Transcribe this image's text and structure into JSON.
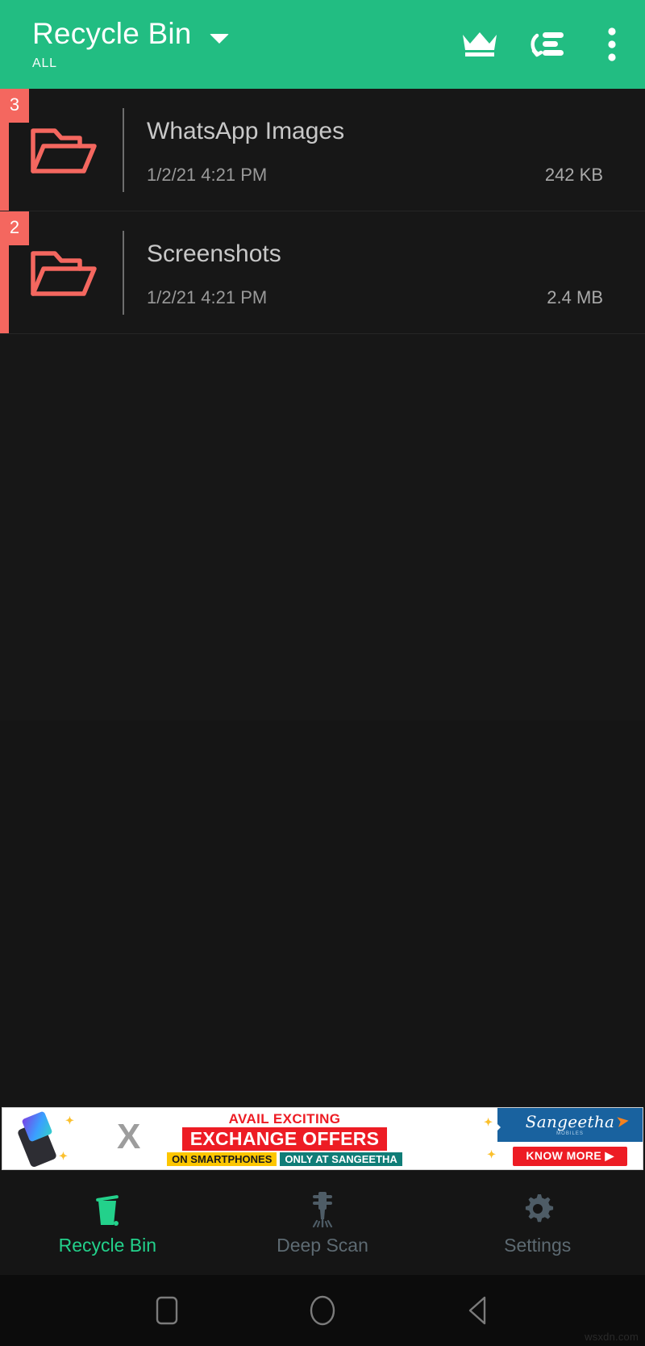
{
  "appbar": {
    "title": "Recycle Bin",
    "subtitle": "ALL",
    "dropdown_icon": "chevron-down-icon",
    "actions": [
      {
        "name": "crown-icon",
        "label": "Premium"
      },
      {
        "name": "sort-icon",
        "label": "Sort"
      },
      {
        "name": "overflow-menu-icon",
        "label": "More options"
      }
    ],
    "background_color": "#22bd82",
    "text_color": "#ffffff"
  },
  "list": {
    "accent_color": "#f4675f",
    "items": [
      {
        "badge": "3",
        "icon": "open-folder-icon",
        "title": "WhatsApp Images",
        "date": "1/2/21 4:21 PM",
        "size": "242 KB"
      },
      {
        "badge": "2",
        "icon": "open-folder-icon",
        "title": "Screenshots",
        "date": "1/2/21 4:21 PM",
        "size": "2.4 MB"
      }
    ]
  },
  "ad": {
    "line1": "AVAIL EXCITING",
    "line2": "EXCHANGE OFFERS",
    "tag_left": "ON SMARTPHONES",
    "tag_right": "ONLY AT SANGEETHA",
    "brand": "Sangeetha",
    "brand_tagline": "MOBILES",
    "cta": "KNOW MORE ▶",
    "cross_mark": "X",
    "colors": {
      "red": "#ed1c24",
      "yellow": "#fdc600",
      "teal": "#0f7d77",
      "blue": "#19629f",
      "orange": "#f5821f"
    }
  },
  "bottomnav": {
    "active_color": "#23d18b",
    "idle_color": "#5d6a72",
    "items": [
      {
        "icon": "trash-bin-icon",
        "label": "Recycle Bin",
        "active": true
      },
      {
        "icon": "jackhammer-icon",
        "label": "Deep Scan",
        "active": false
      },
      {
        "icon": "gear-icon",
        "label": "Settings",
        "active": false
      }
    ]
  },
  "sysnav": {
    "buttons": [
      {
        "name": "recents-button",
        "glyph": "square"
      },
      {
        "name": "home-button",
        "glyph": "circle"
      },
      {
        "name": "back-button",
        "glyph": "triangle-left"
      }
    ]
  },
  "watermark": "wsxdn.com"
}
